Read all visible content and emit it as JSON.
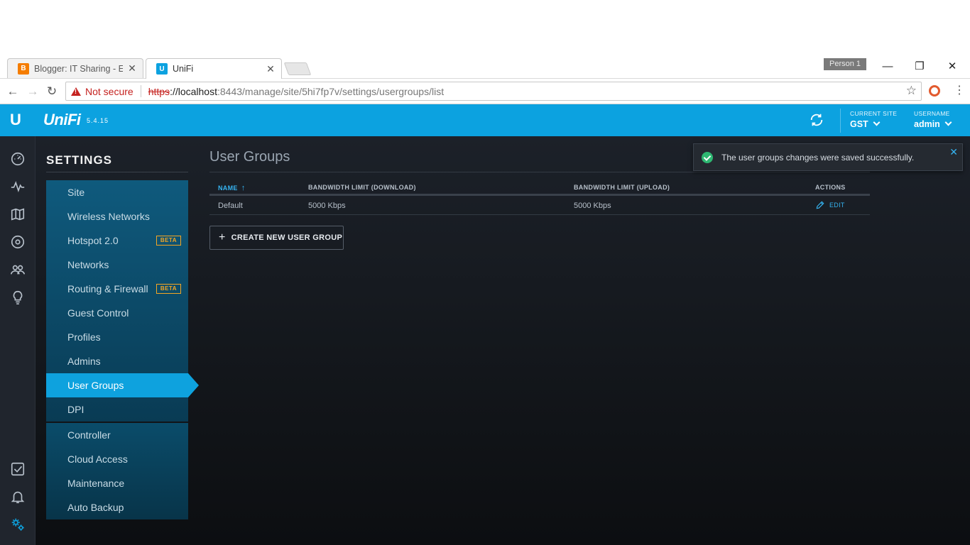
{
  "browser": {
    "tabs": [
      {
        "title": "Blogger: IT Sharing - Edit",
        "icon": "blogger-icon",
        "active": false
      },
      {
        "title": "UniFi",
        "icon": "unifi-icon",
        "active": true
      }
    ],
    "profile": "Person 1",
    "window_controls": {
      "minimize": "—",
      "restore": "❐",
      "close": "✕"
    },
    "security_label": "Not secure",
    "url": {
      "scheme": "https",
      "host": "://localhost",
      "path": ":8443/manage/site/5hi7fp7v/settings/usergroups/list"
    }
  },
  "header": {
    "brand": "UniFi",
    "version": "5.4.15",
    "current_site_label": "CURRENT SITE",
    "current_site": "GST",
    "username_label": "USERNAME",
    "username": "admin",
    "accent_color": "#0ca2e0"
  },
  "rail": {
    "top_icons": [
      "dashboard-icon",
      "statistics-icon",
      "map-icon",
      "devices-icon",
      "clients-icon",
      "insights-icon"
    ],
    "bottom_icons": [
      "events-icon",
      "alerts-icon",
      "settings-icon"
    ]
  },
  "settings": {
    "title": "SETTINGS",
    "primary_items": [
      {
        "label": "Site",
        "badge": ""
      },
      {
        "label": "Wireless Networks",
        "badge": ""
      },
      {
        "label": "Hotspot 2.0",
        "badge": "BETA"
      },
      {
        "label": "Networks",
        "badge": ""
      },
      {
        "label": "Routing & Firewall",
        "badge": "BETA"
      },
      {
        "label": "Guest Control",
        "badge": ""
      },
      {
        "label": "Profiles",
        "badge": ""
      },
      {
        "label": "Admins",
        "badge": ""
      },
      {
        "label": "User Groups",
        "badge": "",
        "active": true
      },
      {
        "label": "DPI",
        "badge": ""
      }
    ],
    "secondary_items": [
      {
        "label": "Controller"
      },
      {
        "label": "Cloud Access"
      },
      {
        "label": "Maintenance"
      },
      {
        "label": "Auto Backup"
      }
    ]
  },
  "main": {
    "title": "User Groups",
    "table": {
      "headers": {
        "name": "NAME",
        "download": "BANDWIDTH LIMIT (DOWNLOAD)",
        "upload": "BANDWIDTH LIMIT (UPLOAD)",
        "actions": "ACTIONS"
      },
      "sort_indicator": "↑",
      "rows": [
        {
          "name": "Default",
          "download": "5000 Kbps",
          "upload": "5000 Kbps",
          "action": "EDIT"
        }
      ]
    },
    "create_button": "CREATE NEW USER GROUP"
  },
  "toast": {
    "message": "The user groups changes were saved successfully.",
    "status_color": "#2eb872"
  }
}
